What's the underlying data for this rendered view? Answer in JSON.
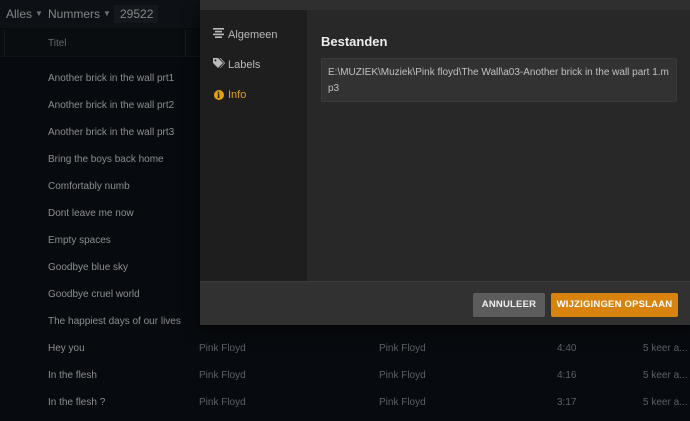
{
  "topbar": {
    "filter_all": "Alles",
    "filter_num": "Nummers",
    "count": "29522"
  },
  "table": {
    "col_title": "Titel",
    "rows": [
      {
        "title": "Another brick in the wall prt1",
        "artist": "",
        "album": "",
        "duration": "",
        "plays": ""
      },
      {
        "title": "Another brick in the wall prt2",
        "artist": "",
        "album": "",
        "duration": "",
        "plays": ""
      },
      {
        "title": "Another brick in the wall prt3",
        "artist": "",
        "album": "",
        "duration": "",
        "plays": ""
      },
      {
        "title": "Bring the boys back home",
        "artist": "",
        "album": "",
        "duration": "",
        "plays": ""
      },
      {
        "title": "Comfortably numb",
        "artist": "",
        "album": "",
        "duration": "",
        "plays": ""
      },
      {
        "title": "Dont leave me now",
        "artist": "",
        "album": "",
        "duration": "",
        "plays": ""
      },
      {
        "title": "Empty spaces",
        "artist": "",
        "album": "",
        "duration": "",
        "plays": ""
      },
      {
        "title": "Goodbye blue sky",
        "artist": "",
        "album": "",
        "duration": "",
        "plays": ""
      },
      {
        "title": "Goodbye cruel world",
        "artist": "",
        "album": "",
        "duration": "",
        "plays": ""
      },
      {
        "title": "The happiest days of our lives",
        "artist": "",
        "album": "",
        "duration": "",
        "plays": ""
      },
      {
        "title": "Hey you",
        "artist": "Pink Floyd",
        "album": "Pink Floyd",
        "duration": "4:40",
        "plays": "5 keer a..."
      },
      {
        "title": "In the flesh",
        "artist": "Pink Floyd",
        "album": "Pink Floyd",
        "duration": "4:16",
        "plays": "5 keer a..."
      },
      {
        "title": "In the flesh ?",
        "artist": "Pink Floyd",
        "album": "Pink Floyd",
        "duration": "3:17",
        "plays": "5 keer a..."
      }
    ]
  },
  "dialog": {
    "sidebar": {
      "general": "Algemeen",
      "labels": "Labels",
      "info": "Info"
    },
    "files_heading": "Bestanden",
    "file_path": "E:\\MUZIEK\\Muziek\\Pink floyd\\The Wall\\a03-Another brick in the wall part 1.mp3",
    "cancel_label": "ANNULEER",
    "save_label": "WIJZIGINGEN OPSLAAN"
  },
  "colors": {
    "accent": "#e5a00d",
    "save_button": "#d9830f",
    "cancel_button": "#5c5c5c"
  },
  "icons": {
    "general": "align-center-icon",
    "labels": "tags-icon",
    "info": "info-circle-icon"
  }
}
